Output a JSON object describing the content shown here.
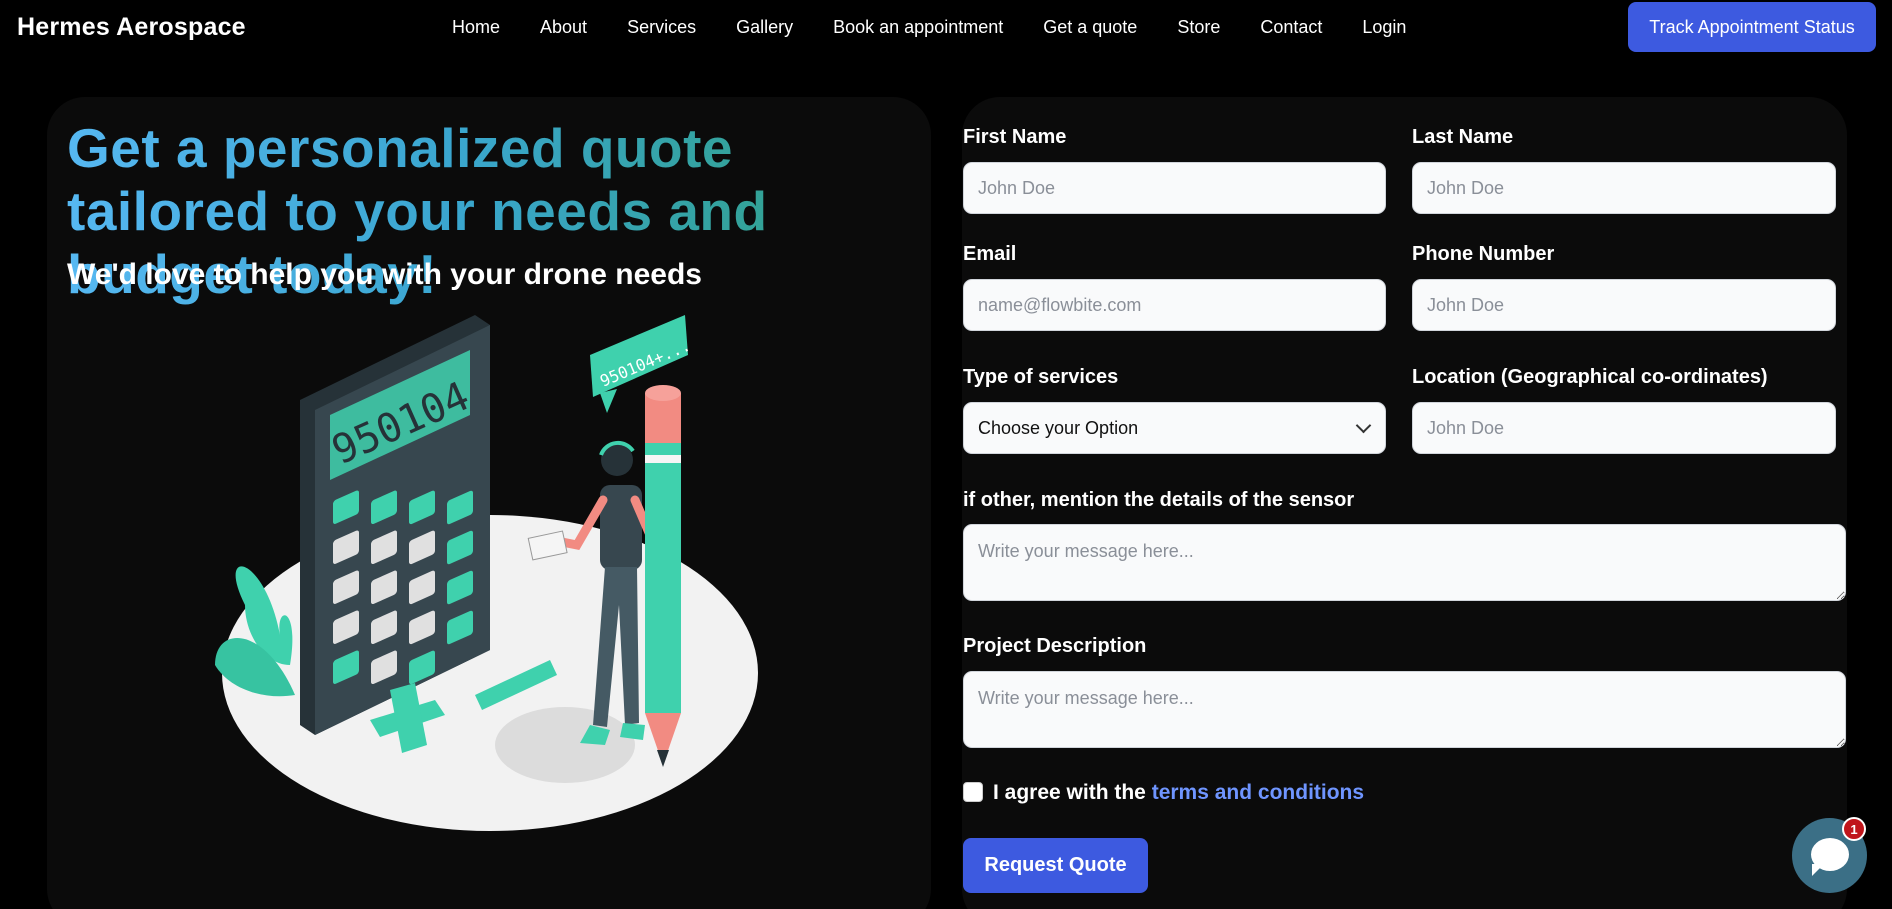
{
  "brand": "Hermes Aerospace",
  "nav": [
    "Home",
    "About",
    "Services",
    "Gallery",
    "Book an appointment",
    "Get a quote",
    "Store",
    "Contact",
    "Login"
  ],
  "track_button": "Track Appointment Status",
  "hero": {
    "headline": "Get a personalized quote tailored to your needs and budget today!",
    "subline": "We'd love to help you with your drone needs",
    "calculator_display": "950104",
    "speech_bubble": "950104+..."
  },
  "form": {
    "first_name": {
      "label": "First Name",
      "placeholder": "John Doe"
    },
    "last_name": {
      "label": "Last Name",
      "placeholder": "John Doe"
    },
    "email": {
      "label": "Email",
      "placeholder": "name@flowbite.com"
    },
    "phone": {
      "label": "Phone Number",
      "placeholder": "John Doe"
    },
    "service_type": {
      "label": "Type of services",
      "selected": "Choose your Option"
    },
    "location": {
      "label": "Location (Geographical co-ordinates)",
      "placeholder": "John Doe"
    },
    "sensor_details": {
      "label": "if other, mention the details of the sensor",
      "placeholder": "Write your message here..."
    },
    "project_description": {
      "label": "Project Description",
      "placeholder": "Write your message here..."
    },
    "agree_prefix": "I agree with the ",
    "agree_link": "terms and conditions",
    "submit": "Request Quote"
  },
  "chat": {
    "badge_count": "1"
  },
  "colors": {
    "accent": "#3d5ae0",
    "teal": "#3fd1ad",
    "link": "#6f95ff",
    "badge": "#c0151b"
  }
}
